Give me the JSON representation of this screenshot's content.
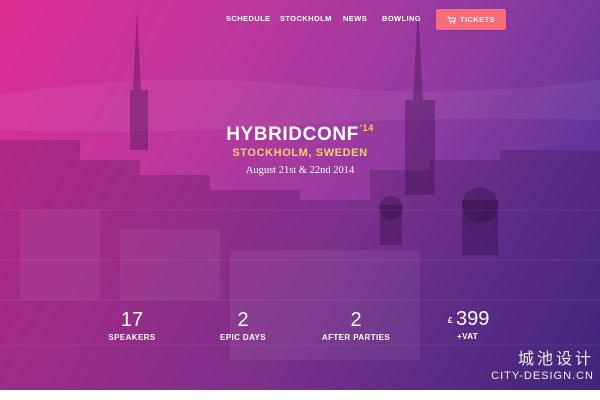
{
  "nav": {
    "items": [
      {
        "label": "SCHEDULE"
      },
      {
        "label": "STOCKHOLM"
      },
      {
        "label": "NEWS"
      },
      {
        "label": "BOWLING"
      }
    ],
    "tickets_label": "TICKETS",
    "tickets_icon": "cart-icon"
  },
  "hero": {
    "title": "HYBRIDCONF",
    "title_superscript": "'14",
    "location": "STOCKHOLM, SWEDEN",
    "dates": "August 21st & 22nd 2014"
  },
  "stats": [
    {
      "number": "17",
      "label": "SPEAKERS"
    },
    {
      "number": "2",
      "label": "EPIC DAYS"
    },
    {
      "number": "2",
      "label": "AFTER PARTIES"
    }
  ],
  "price": {
    "currency": "£",
    "amount": "399",
    "note": "+VAT"
  },
  "watermark": {
    "chinese": "城池设计",
    "english": "CITY-DESIGN.CN"
  },
  "colors": {
    "accent_pink": "#e7309a",
    "accent_purple": "#4b2f93",
    "button": "#fb6c78",
    "highlight_yellow": "#f4d35e"
  }
}
